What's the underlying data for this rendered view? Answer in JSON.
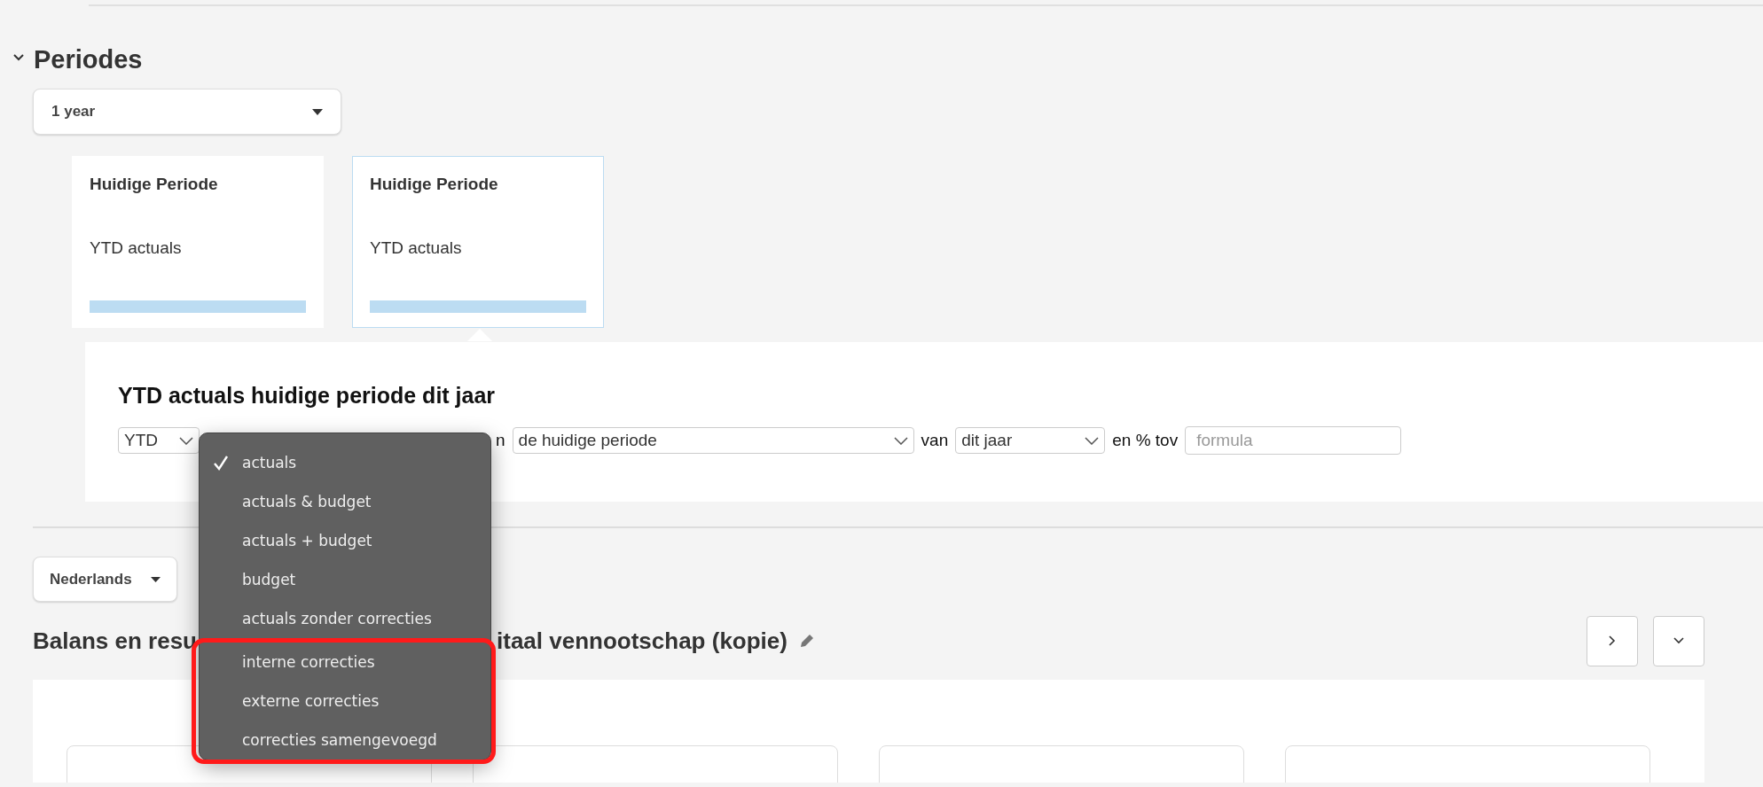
{
  "section": {
    "title": "Periodes",
    "expanded": true
  },
  "period_select": {
    "value": "1 year"
  },
  "period_cards": [
    {
      "title": "Huidige Periode",
      "subtitle": "YTD actuals",
      "selected": false
    },
    {
      "title": "Huidige Periode",
      "subtitle": "YTD actuals",
      "selected": true
    }
  ],
  "detail": {
    "title": "YTD actuals huidige periode dit jaar",
    "row": [
      {
        "kind": "select",
        "value": "YTD"
      },
      {
        "kind": "hidden"
      },
      {
        "kind": "text",
        "value": "n"
      },
      {
        "kind": "select",
        "value": "de huidige periode"
      },
      {
        "kind": "text",
        "value": "van"
      },
      {
        "kind": "select",
        "value": "dit jaar"
      },
      {
        "kind": "text",
        "value": "en % tov"
      },
      {
        "kind": "input",
        "placeholder": "formula"
      }
    ]
  },
  "menu": {
    "items": [
      {
        "label": "actuals",
        "selected": true,
        "highlighted": false
      },
      {
        "label": "actuals & budget",
        "selected": false,
        "highlighted": false
      },
      {
        "label": "actuals + budget",
        "selected": false,
        "highlighted": false
      },
      {
        "label": "budget",
        "selected": false,
        "highlighted": false
      },
      {
        "label": "actuals zonder correcties",
        "selected": false,
        "highlighted": false
      },
      {
        "label": "interne correcties",
        "selected": false,
        "highlighted": true
      },
      {
        "label": "externe correcties",
        "selected": false,
        "highlighted": true
      },
      {
        "label": "correcties samengevoegd",
        "selected": false,
        "highlighted": true
      }
    ]
  },
  "language_select": {
    "value": "Nederlands"
  },
  "report": {
    "title_parts": [
      "Balans en resu",
      "itaal vennootschap (kopie)"
    ]
  }
}
